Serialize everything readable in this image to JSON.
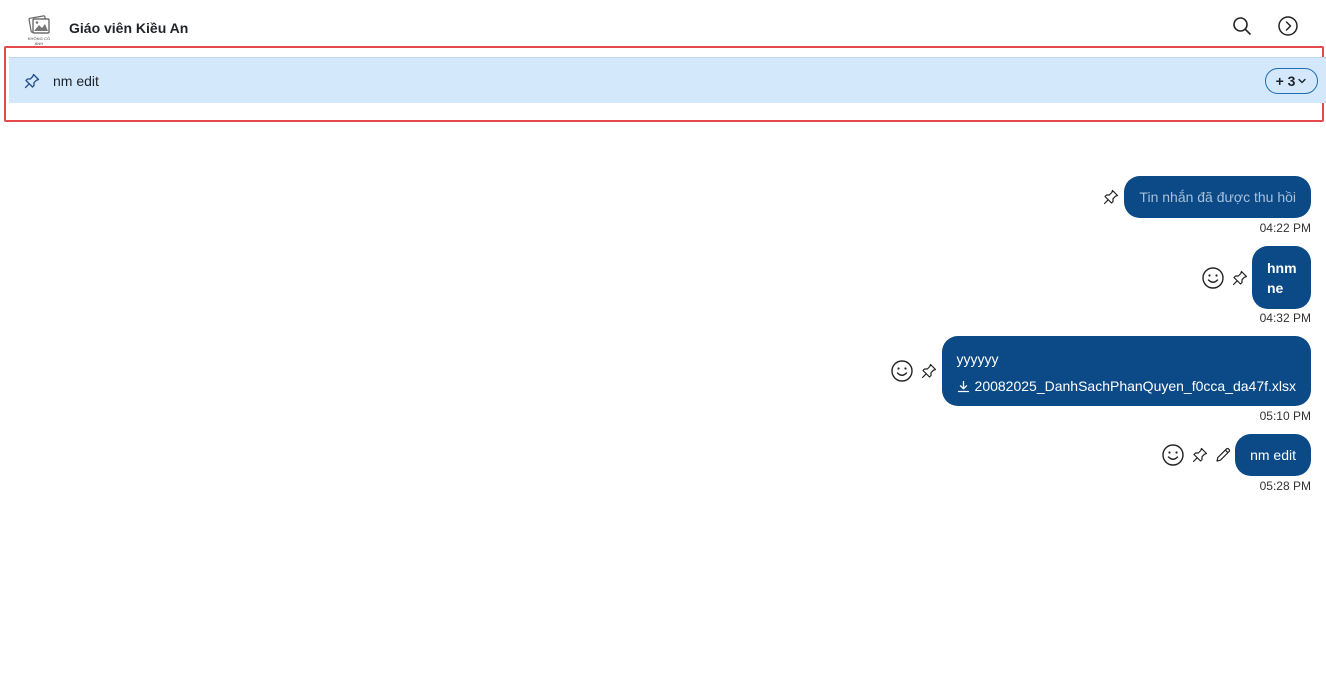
{
  "header": {
    "avatar_text": "KHÔNG CÓ ẢNH",
    "title": "Giáo viên Kiều An",
    "search_icon": "search-icon",
    "forward_icon": "chevron-right-circle-icon"
  },
  "pinned": {
    "icon": "pin-icon",
    "text": "nm edit",
    "more_label": "+ 3",
    "frame_color": "#e5484d",
    "background": "#d3e8fb"
  },
  "messages": [
    {
      "text": "Tin nhắn đã được thu hồi",
      "time": "04:22 PM",
      "recalled": true
    },
    {
      "lines": [
        "hnm",
        "ne"
      ],
      "time": "04:32 PM"
    },
    {
      "text": "yyyyyy",
      "attachment": "20082025_DanhSachPhanQuyen_f0cca_da47f.xlsx",
      "time": "05:10 PM"
    },
    {
      "text": "nm edit",
      "time": "05:28 PM"
    }
  ],
  "colors": {
    "bubble": "#0b4a86",
    "accent": "#1f6fb2"
  }
}
